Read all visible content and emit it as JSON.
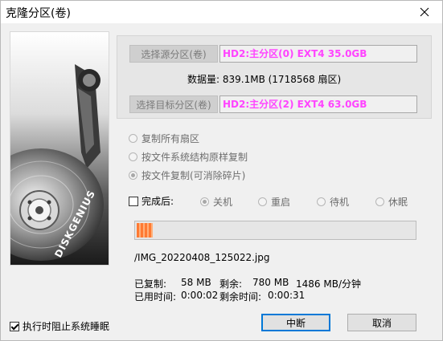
{
  "window": {
    "title": "克隆分区(卷)"
  },
  "source": {
    "button_label": "选择源分区(卷)",
    "partition": "HD2:主分区(0) EXT4 35.0GB"
  },
  "data_amount": "数据量: 839.1MB (1718568 扇区)",
  "target": {
    "button_label": "选择目标分区(卷)",
    "partition": "HD2:主分区(2) EXT4 63.0GB"
  },
  "copy_modes": [
    {
      "label": "复制所有扇区",
      "checked": false
    },
    {
      "label": "按文件系统结构原样复制",
      "checked": false
    },
    {
      "label": "按文件复制(可消除碎片)",
      "checked": true
    }
  ],
  "after_done": {
    "label": "完成后:",
    "checked": false,
    "options": [
      {
        "label": "关机",
        "checked": true
      },
      {
        "label": "重启",
        "checked": false
      },
      {
        "label": "待机",
        "checked": false
      },
      {
        "label": "休眠",
        "checked": false
      }
    ]
  },
  "progress": {
    "fraction": 0.057
  },
  "current_file": "/IMG_20220408_125022.jpg",
  "stats": {
    "copied_label": "已复制:",
    "copied_value": "58 MB",
    "remaining_label": "剩余:",
    "remaining_value": "780 MB",
    "speed": "1486 MB/分钟",
    "elapsed_label": "已用时间:",
    "elapsed_value": "0:00:02",
    "time_left_label": "剩余时间:",
    "time_left_value": "0:00:31"
  },
  "prevent_sleep": {
    "label": "执行时阻止系统睡眠",
    "checked": true
  },
  "buttons": {
    "interrupt": "中断",
    "cancel": "取消"
  },
  "logo_text": "DISKGENIUS"
}
